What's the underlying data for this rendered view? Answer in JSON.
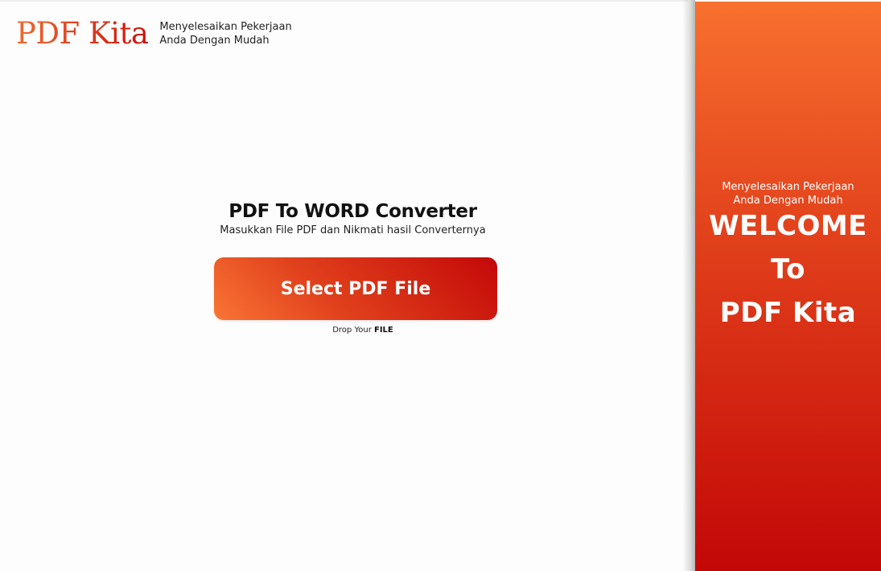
{
  "header": {
    "logo_text": "PDF Kita",
    "tagline_line1": "Menyelesaikan Pekerjaan",
    "tagline_line2": "Anda Dengan Mudah"
  },
  "main": {
    "title": "PDF To WORD Converter",
    "subtitle": "Masukkan File PDF dan Nikmati hasil Converternya",
    "select_button_label": "Select PDF File",
    "drop_prefix": "Drop Your",
    "drop_emphasis": "FILE"
  },
  "side_panel": {
    "tagline_line1": "Menyelesaikan Pekerjaan",
    "tagline_line2": "Anda Dengan Mudah",
    "welcome_line1": "WELCOME",
    "welcome_line2": "To",
    "welcome_line3": "PDF Kita"
  },
  "colors": {
    "accent_light": "#f97535",
    "accent_dark": "#c30808",
    "background": "#fdfdfd"
  }
}
